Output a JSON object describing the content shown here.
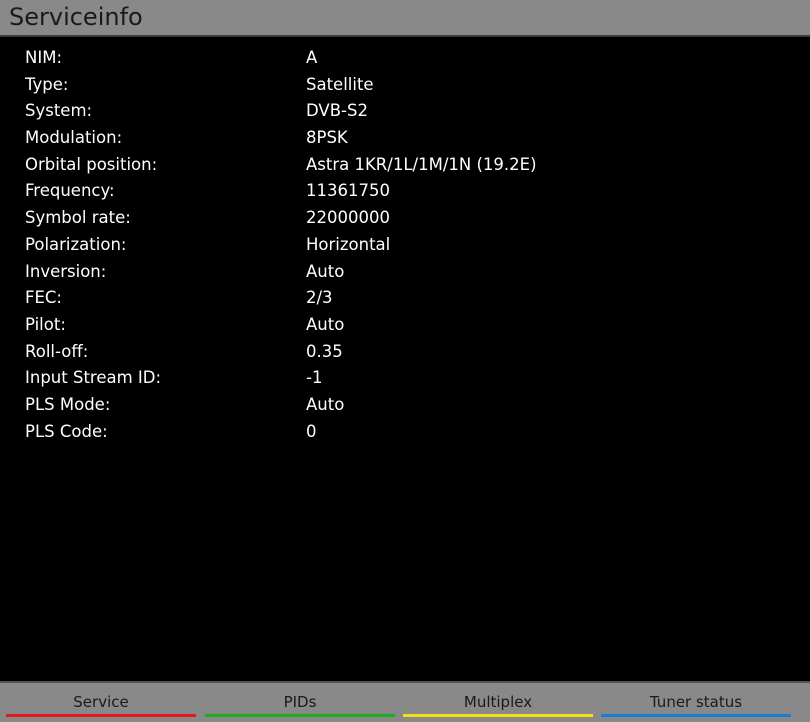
{
  "header": {
    "title": "Serviceinfo"
  },
  "rows": [
    {
      "label": "NIM:",
      "value": "A"
    },
    {
      "label": "Type:",
      "value": "Satellite"
    },
    {
      "label": "System:",
      "value": "DVB-S2"
    },
    {
      "label": "Modulation:",
      "value": "8PSK"
    },
    {
      "label": "Orbital position:",
      "value": "Astra 1KR/1L/1M/1N (19.2E)"
    },
    {
      "label": "Frequency:",
      "value": "11361750"
    },
    {
      "label": "Symbol rate:",
      "value": "22000000"
    },
    {
      "label": "Polarization:",
      "value": "Horizontal"
    },
    {
      "label": "Inversion:",
      "value": "Auto"
    },
    {
      "label": "FEC:",
      "value": "2/3"
    },
    {
      "label": "Pilot:",
      "value": "Auto"
    },
    {
      "label": "Roll-off:",
      "value": "0.35"
    },
    {
      "label": "Input Stream ID:",
      "value": "-1"
    },
    {
      "label": "PLS Mode:",
      "value": "Auto"
    },
    {
      "label": "PLS Code:",
      "value": "0"
    }
  ],
  "footer": {
    "buttons": [
      {
        "label": "Service",
        "color": "#e41b1b"
      },
      {
        "label": "PIDs",
        "color": "#1fae1f"
      },
      {
        "label": "Multiplex",
        "color": "#f0e010"
      },
      {
        "label": "Tuner status",
        "color": "#1a7fd0"
      }
    ]
  }
}
